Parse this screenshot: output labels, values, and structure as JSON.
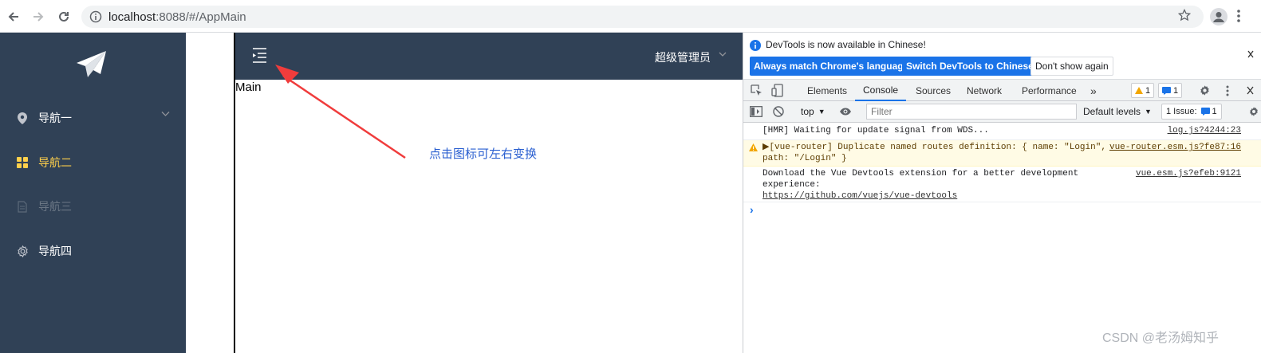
{
  "browser": {
    "url_host": "localhost",
    "url_rest": ":8088/#/AppMain"
  },
  "sidebar": {
    "items": [
      {
        "label": "导航一",
        "icon": "location-pin-icon",
        "color": "#ffffff"
      },
      {
        "label": "导航二",
        "icon": "grid-icon",
        "color": "#ffd04b"
      },
      {
        "label": "导航三",
        "icon": "document-icon",
        "color": "#6b7785"
      },
      {
        "label": "导航四",
        "icon": "gear-icon",
        "color": "#ffffff"
      }
    ]
  },
  "app": {
    "admin_label": "超级管理员",
    "main_text": "Main",
    "annotation": "点击图标可左右变换",
    "header_color": "#304156",
    "arrow_color": "#f03c3c"
  },
  "devtools": {
    "info_message": "DevTools is now available in Chinese!",
    "btn_always": "Always match Chrome's language",
    "btn_switch": "Switch DevTools to Chinese",
    "btn_dont_show": "Don't show again",
    "tabs": [
      "Elements",
      "Console",
      "Sources",
      "Network",
      "Performance"
    ],
    "active_tab": "Console",
    "warn_count": "1",
    "msg_count": "1",
    "context": "top",
    "filter_placeholder": "Filter",
    "levels": "Default levels",
    "issues": "1 Issue:",
    "issues_count": "1",
    "console": [
      {
        "text": "[HMR] Waiting for update signal from WDS...",
        "source": "log.js?4244:23"
      },
      {
        "text1": "▶[vue-router] Duplicate named routes definition: { name: \"Login\",",
        "text2": "path: \"/Login\" }",
        "source": "vue-router.esm.js?fe87:16"
      },
      {
        "text1": "Download the Vue Devtools extension for a better development",
        "text2": "experience:",
        "link": "https://github.com/vuejs/vue-devtools",
        "source": "vue.esm.js?efeb:9121"
      }
    ],
    "prompt": "›"
  },
  "watermark": "CSDN @老汤姆知乎"
}
